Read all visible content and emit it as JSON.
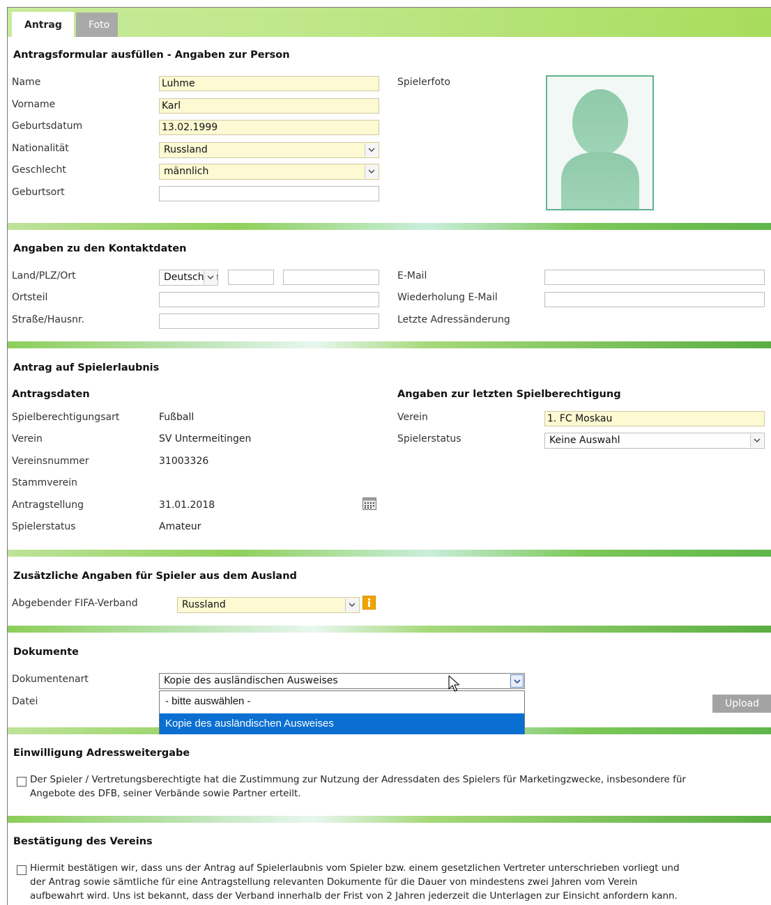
{
  "tabs": [
    {
      "label": "Antrag"
    },
    {
      "label": "Foto"
    }
  ],
  "person": {
    "heading": "Antragsformular ausfüllen - Angaben zur Person",
    "name_label": "Name",
    "name_value": "Luhme",
    "vorname_label": "Vorname",
    "vorname_value": "Karl",
    "geburtsdatum_label": "Geburtsdatum",
    "geburtsdatum_value": "13.02.1999",
    "nationalitaet_label": "Nationalität",
    "nationalitaet_value": "Russland",
    "geschlecht_label": "Geschlecht",
    "geschlecht_value": "männlich",
    "geburtsort_label": "Geburtsort",
    "geburtsort_value": "",
    "spielerfoto_label": "Spielerfoto"
  },
  "kontakt": {
    "heading": "Angaben zu den Kontaktdaten",
    "land_label": "Land/PLZ/Ort",
    "land_value": "Deutschland",
    "plz_value": "",
    "ort_value": "",
    "ortsteil_label": "Ortsteil",
    "ortsteil_value": "",
    "strasse_label": "Straße/Hausnr.",
    "strasse_value": "",
    "email_label": "E-Mail",
    "email_value": "",
    "email2_label": "Wiederholung E-Mail",
    "email2_value": "",
    "adressaenderung_label": "Letzte Adressänderung"
  },
  "antrag": {
    "heading": "Antrag auf Spielerlaubnis",
    "antragsdaten_heading": "Antragsdaten",
    "art_label": "Spielberechtigungsart",
    "art_value": "Fußball",
    "verein_label": "Verein",
    "verein_value": "SV Untermeitingen",
    "vereinsnummer_label": "Vereinsnummer",
    "vereinsnummer_value": "31003326",
    "stammverein_label": "Stammverein",
    "antragstellung_label": "Antragstellung",
    "antragstellung_value": "31.01.2018",
    "spielerstatus_label": "Spielerstatus",
    "spielerstatus_value": "Amateur",
    "letzte_heading": "Angaben zur letzten Spielberechtigung",
    "letzte_verein_label": "Verein",
    "letzte_verein_value": "1. FC Moskau",
    "letzte_status_label": "Spielerstatus",
    "letzte_status_value": "Keine Auswahl"
  },
  "ausland": {
    "heading": "Zusätzliche Angaben für Spieler aus dem Ausland",
    "fifa_label": "Abgebender FIFA-Verband",
    "fifa_value": "Russland"
  },
  "dokumente": {
    "heading": "Dokumente",
    "art_label": "Dokumentenart",
    "art_value": "Kopie des ausländischen Ausweises",
    "datei_label": "Datei",
    "options": [
      "- bitte auswählen -",
      "Kopie des ausländischen Ausweises"
    ],
    "upload_label": "Upload"
  },
  "einwilligung": {
    "heading": "Einwilligung Adressweitergabe",
    "text_line1": "Der Spieler / Vertretungsberechtigte hat die Zustimmung zur Nutzung der Adressdaten des Spielers für Marketingzwecke, insbesondere für",
    "text_line2": "Angebote des DFB, seiner Verbände sowie Partner erteilt."
  },
  "bestaetigung": {
    "heading": "Bestätigung des Vereins",
    "text_line1": "Hiermit bestätigen wir, dass uns der Antrag auf Spielerlaubnis vom Spieler bzw. einem gesetzlichen Vertreter unterschrieben vorliegt und",
    "text_line2": "der Antrag sowie sämtliche für eine Antragstellung relevanten Dokumente für die Dauer von mindestens zwei Jahren vom Verein",
    "text_line3": "aufbewahrt wird. Uns ist bekannt, dass der Verband innerhalb der Frist von 2 Jahren jederzeit die Unterlagen zur Einsicht anfordern kann."
  },
  "colors": {
    "accent_green": "#8fd05a",
    "field_yellow": "#fdf9d3",
    "selection_blue": "#0a6fd1"
  }
}
